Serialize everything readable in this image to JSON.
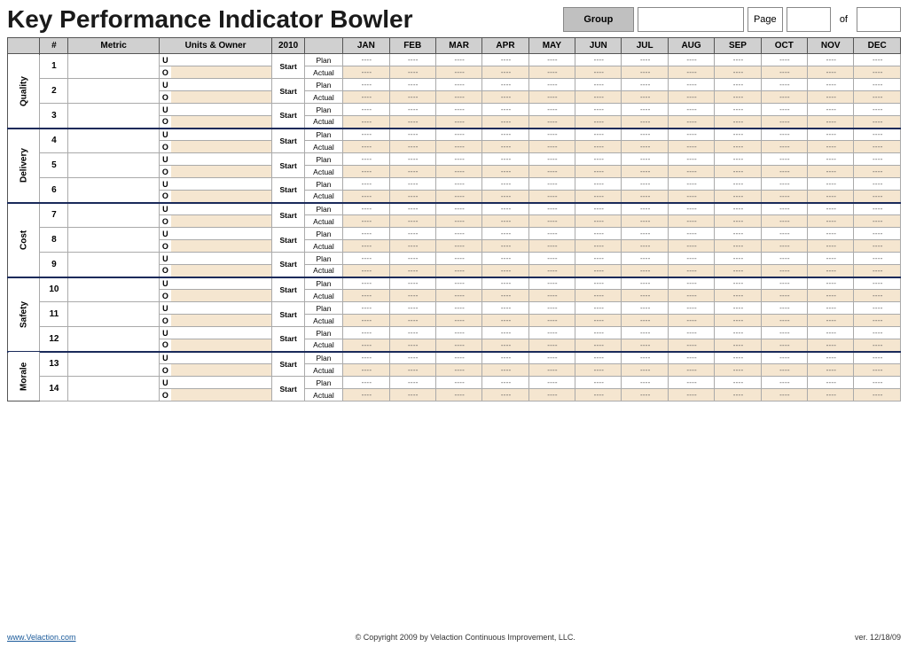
{
  "header": {
    "title": "Key Performance Indicator Bowler",
    "group_label": "Group",
    "page_label": "Page",
    "of_label": "of",
    "year": "2010"
  },
  "columns": {
    "months": [
      "JAN",
      "FEB",
      "MAR",
      "APR",
      "MAY",
      "JUN",
      "JUL",
      "AUG",
      "SEP",
      "OCT",
      "NOV",
      "DEC"
    ]
  },
  "categories": [
    {
      "name": "Quality",
      "rows": [
        {
          "num": "1"
        },
        {
          "num": "2"
        },
        {
          "num": "3"
        }
      ]
    },
    {
      "name": "Delivery",
      "rows": [
        {
          "num": "4"
        },
        {
          "num": "5"
        },
        {
          "num": "6"
        }
      ]
    },
    {
      "name": "Cost",
      "rows": [
        {
          "num": "7"
        },
        {
          "num": "8"
        },
        {
          "num": "9"
        }
      ]
    },
    {
      "name": "Safety",
      "rows": [
        {
          "num": "10"
        },
        {
          "num": "11"
        },
        {
          "num": "12"
        }
      ]
    },
    {
      "name": "Morale",
      "rows": [
        {
          "num": "13"
        },
        {
          "num": "14"
        }
      ]
    }
  ],
  "footer": {
    "link_text": "www.Velaction.com",
    "copyright": "© Copyright 2009 by Velaction Continuous Improvement, LLC.",
    "version": "ver. 12/18/09"
  },
  "labels": {
    "num": "#",
    "metric": "Metric",
    "units_owner": "Units & Owner",
    "start": "Start",
    "plan": "Plan",
    "actual": "Actual"
  }
}
